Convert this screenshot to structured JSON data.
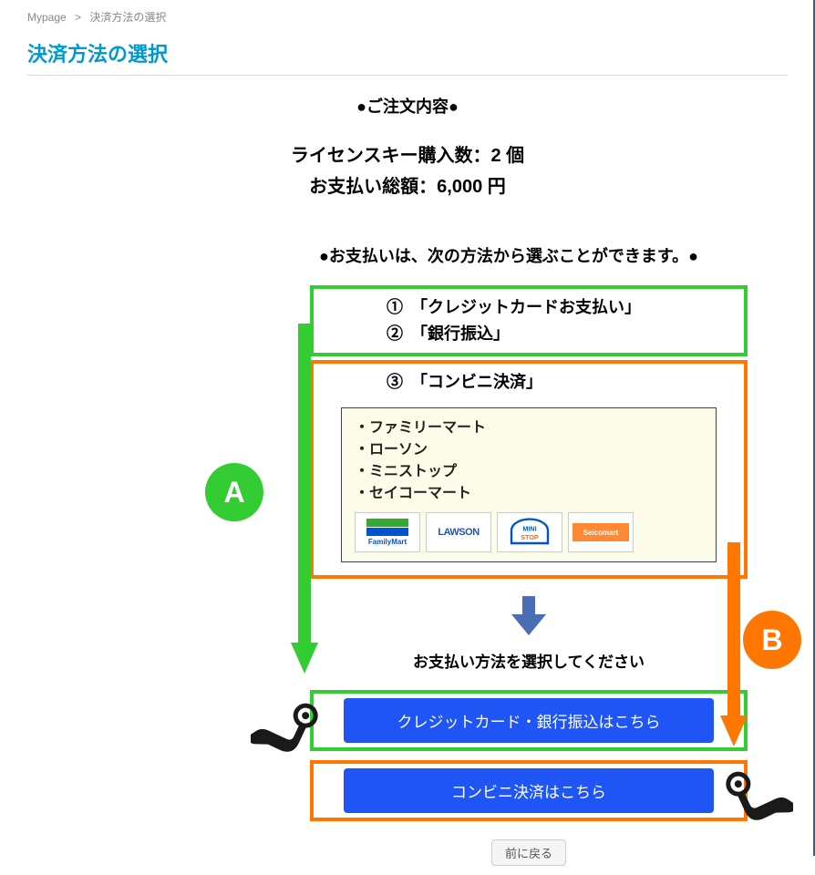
{
  "breadcrumb": {
    "item1": "Mypage",
    "sep": ">",
    "item2": "決済方法の選択"
  },
  "page_title": "決済方法の選択",
  "order": {
    "header": "●ご注文内容●",
    "qty_line": "ライセンスキー購入数：2 個",
    "total_line": "お支払い総額：6,000 円"
  },
  "payment": {
    "intro": "●お支払いは、次の方法から選ぶことができます。●",
    "option1": "①　「クレジットカードお支払い」",
    "option2": "②　「銀行振込」",
    "option3": "③　「コンビニ決済」",
    "stores": {
      "s1": "・ファミリーマート",
      "s2": "・ローソン",
      "s3": "・ミニストップ",
      "s4": "・セイコーマート"
    },
    "logos": {
      "familymart": "FamilyMart",
      "lawson": "LAWSON",
      "ministop": "MINI STOP",
      "seicomart": "Seicomart"
    },
    "select_prompt": "お支払い方法を選択してください",
    "btn_credit": "クレジットカード・銀行振込はこちら",
    "btn_conv": "コンビニ決済はこちら",
    "back": "前に戻る"
  },
  "annotations": {
    "badge_a": "A",
    "badge_b": "B"
  }
}
